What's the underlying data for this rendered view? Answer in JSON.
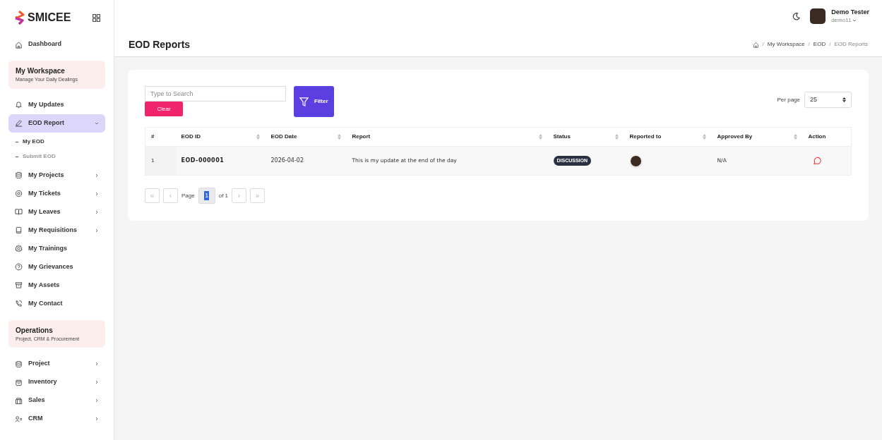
{
  "brand": {
    "name": "SMICEE"
  },
  "sidebar": {
    "items": [
      {
        "kind": "link",
        "label": "Dashboard",
        "selected": false
      },
      {
        "kind": "section",
        "title": "My Workspace",
        "subtitle": "Manage Your Daily Dealings"
      },
      {
        "kind": "link",
        "label": "My Updates",
        "selected": false
      },
      {
        "kind": "menu",
        "label": "EOD Report",
        "selected": true,
        "expanded": true,
        "children": [
          {
            "label": "My EOD",
            "selected": true
          },
          {
            "label": "Submit EOD",
            "selected": false
          }
        ]
      },
      {
        "kind": "menu",
        "label": "My Projects",
        "selected": false,
        "expanded": false
      },
      {
        "kind": "menu",
        "label": "My Tickets",
        "selected": false,
        "expanded": false
      },
      {
        "kind": "menu",
        "label": "My Leaves",
        "selected": false,
        "expanded": false
      },
      {
        "kind": "menu",
        "label": "My Requisitions",
        "selected": false,
        "expanded": false
      },
      {
        "kind": "link",
        "label": "My Trainings",
        "selected": false
      },
      {
        "kind": "link",
        "label": "My Grievances",
        "selected": false
      },
      {
        "kind": "link",
        "label": "My Assets",
        "selected": false
      },
      {
        "kind": "link",
        "label": "My Contact",
        "selected": false
      },
      {
        "kind": "section",
        "title": "Operations",
        "subtitle": "Project, CRM & Procurement"
      },
      {
        "kind": "menu",
        "label": "Project",
        "selected": false,
        "expanded": false
      },
      {
        "kind": "menu",
        "label": "Inventory",
        "selected": false,
        "expanded": false
      },
      {
        "kind": "menu",
        "label": "Sales",
        "selected": false,
        "expanded": false
      },
      {
        "kind": "menu",
        "label": "CRM",
        "selected": false,
        "expanded": false
      }
    ]
  },
  "user": {
    "name": "Demo Tester",
    "username": "demo11"
  },
  "page": {
    "title": "EOD Reports",
    "breadcrumb": [
      "My Workspace",
      "EOD",
      "EOD Reports"
    ],
    "breadcrumb_separator": "/"
  },
  "toolbar": {
    "search": {
      "placeholder": "Type to Search"
    },
    "clear_button": "Clear",
    "filter_button": "Filter",
    "per_page_label": "Per page",
    "per_page": "25"
  },
  "table": {
    "columns": [
      {
        "label": "#",
        "sortable": false
      },
      {
        "label": "EOD ID",
        "sortable": true
      },
      {
        "label": "EOD Date",
        "sortable": true
      },
      {
        "label": "Report",
        "sortable": true
      },
      {
        "label": "Status",
        "sortable": true
      },
      {
        "label": "Reported to",
        "sortable": true
      },
      {
        "label": "Approved By",
        "sortable": true
      },
      {
        "label": "Action",
        "sortable": false
      }
    ],
    "rows": [
      {
        "number": "1",
        "eod_id": "EOD-000001",
        "eod_date": "2026-04-02",
        "report": "This is my update at the end of the day",
        "status": "DISCUSSION",
        "approved_by": "N/A"
      }
    ]
  },
  "pagination": {
    "first": "«",
    "prev": "‹",
    "page_label": "Page",
    "page": "1",
    "of": "of 1",
    "next": "›",
    "last": "»",
    "first_disabled": true,
    "prev_disabled": true,
    "next_disabled": true,
    "last_disabled": true
  }
}
